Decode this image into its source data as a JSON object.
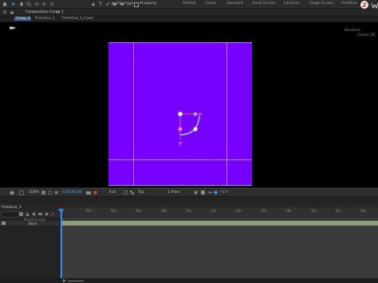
{
  "toolbar": {
    "tools": [
      "home-icon",
      "selection-icon",
      "hand-icon",
      "zoom-icon",
      "orbit-icon",
      "pan-icon",
      "dolly-icon",
      "pen-icon",
      "text-icon",
      "brush-icon",
      "clone-icon",
      "eraser-icon",
      "roto-icon",
      "puppet-icon"
    ],
    "universal_label": "Universal",
    "snapping_label": "Snapping",
    "workspaces": [
      "Default",
      "Learn",
      "Standard",
      "Small Screen",
      "Libraries",
      "Single Screen",
      "Primitive"
    ]
  },
  "panel_tabs": {
    "composition_tab": "Composition Comp 1",
    "breadcrumb": [
      "Comp 1",
      "Primitive_1",
      "Primitive_1_Fixed"
    ]
  },
  "viewer": {
    "renderer_label": "Renderer:",
    "classic_label": "Classic 3D"
  },
  "viewer_bar": {
    "zoom": "100%",
    "timecode": "0;00;00;00",
    "resolution": "Full",
    "view": "Top",
    "views": "1 View",
    "exposure": "+0.0"
  },
  "timeline": {
    "tab": "Primitive_1",
    "search_placeholder": "",
    "parent_label": "Parent & Link",
    "layer_parent": "None",
    "ruler_ticks": [
      "0s",
      "02s",
      "04s",
      "06s",
      "08s",
      "10s",
      "12s",
      "14s",
      "16s",
      "18s",
      "20s",
      "22s",
      "24s"
    ]
  },
  "colors": {
    "composition": "#7700ff",
    "guides": "#c89dff",
    "layer_bar": "#8f9a7c",
    "accent": "#2d8ceb"
  }
}
